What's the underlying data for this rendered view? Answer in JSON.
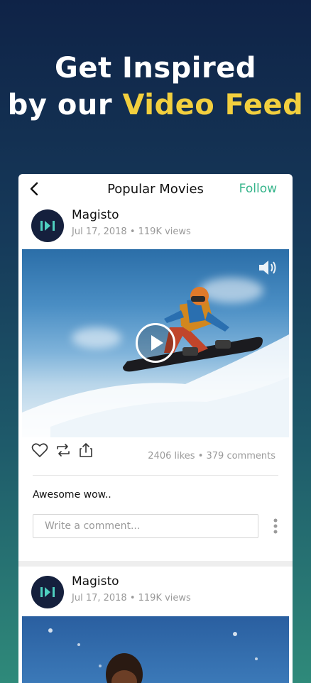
{
  "headline": {
    "line1": "Get Inspired",
    "line2_prefix": "by our ",
    "line2_accent": "Video Feed"
  },
  "colors": {
    "accent": "#f2cf3e",
    "follow": "#34b48a",
    "avatar_bg": "#15203d"
  },
  "topbar": {
    "title": "Popular Movies",
    "follow_label": "Follow",
    "back_icon": "chevron-left-icon"
  },
  "posts": [
    {
      "author": "Magisto",
      "meta": "Jul 17, 2018 • 119K views"
    },
    {
      "author": "Magisto",
      "meta": "Jul 17, 2018 • 119K views"
    }
  ],
  "post_actions": {
    "stats": "2406 likes • 379 comments",
    "icons": [
      "heart-icon",
      "repost-icon",
      "share-icon"
    ]
  },
  "caption": "Awesome wow..",
  "comment": {
    "placeholder": "Write a comment..."
  },
  "video": {
    "play_icon": "play-icon",
    "sound_icon": "sound-icon"
  }
}
